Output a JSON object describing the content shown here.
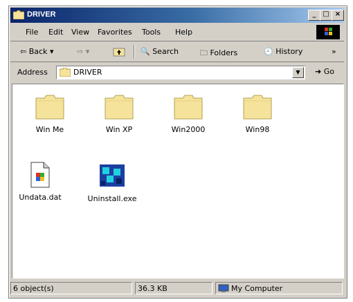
{
  "window": {
    "title": "DRIVER"
  },
  "titlebar_buttons": {
    "minimize": "_",
    "maximize": "□",
    "close": "×"
  },
  "menu": [
    "File",
    "Edit",
    "View",
    "Favorites",
    "Tools",
    "Help"
  ],
  "toolbar": {
    "back": "Back",
    "search": "Search",
    "folders": "Folders",
    "history": "History",
    "more": "»"
  },
  "address": {
    "label": "Address",
    "value": "DRIVER",
    "go": "Go"
  },
  "items": [
    {
      "label": "Win Me",
      "icon": "folder-icon"
    },
    {
      "label": "Win XP",
      "icon": "folder-icon"
    },
    {
      "label": "Win2000",
      "icon": "folder-icon"
    },
    {
      "label": "Win98",
      "icon": "folder-icon"
    },
    {
      "label": "Undata.dat",
      "icon": "data-file-icon"
    },
    {
      "label": "Uninstall.exe",
      "icon": "executable-icon"
    }
  ],
  "status": {
    "objects": "6 object(s)",
    "size": "36.3 KB",
    "location": "My Computer"
  },
  "colors": {
    "title_start": "#0a246a",
    "title_end": "#a6caf0",
    "folder": "#f5e39b",
    "chrome": "#d4d0c8"
  }
}
